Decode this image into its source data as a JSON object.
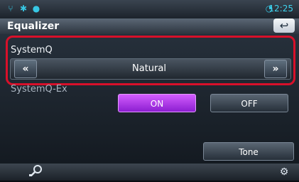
{
  "status": {
    "time": "12:25",
    "icons": [
      "usb-icon",
      "bluetooth-icon",
      "record-icon",
      "wifi-icon"
    ]
  },
  "header": {
    "title": "Equalizer",
    "back_icon": "back-arrow-icon"
  },
  "systemq": {
    "label": "SystemQ",
    "value": "Natural",
    "prev_label": "«",
    "next_label": "»"
  },
  "systemq_ex": {
    "label": "SystemQ-Ex",
    "on_label": "ON",
    "off_label": "OFF",
    "selected": "ON"
  },
  "tone": {
    "label": "Tone"
  },
  "bottom": {
    "left_icon": "search-graph-icon",
    "right_icon": "gear-icon"
  },
  "colors": {
    "accent_on": "#b43ef0",
    "highlight": "#d8102a",
    "time": "#3fd3ee"
  }
}
